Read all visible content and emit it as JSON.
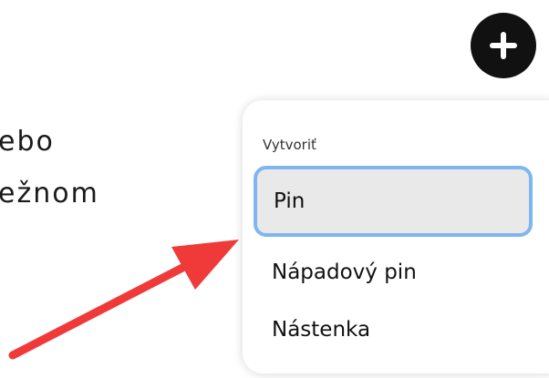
{
  "background_text": {
    "line1": "ebo",
    "line2": "ežnom"
  },
  "create_menu": {
    "header": "Vytvoriť",
    "items": [
      {
        "label": "Pin",
        "selected": true
      },
      {
        "label": "Nápadový pin",
        "selected": false
      },
      {
        "label": "Nástenka",
        "selected": false
      }
    ]
  },
  "colors": {
    "plus_button": "#111111",
    "selected_item_bg": "#e9e9e9",
    "focus_ring": "#7fb6f2",
    "annotation_arrow": "#f03a3a"
  },
  "icons": {
    "create_button": "plus-icon",
    "annotation": "red-arrow"
  }
}
